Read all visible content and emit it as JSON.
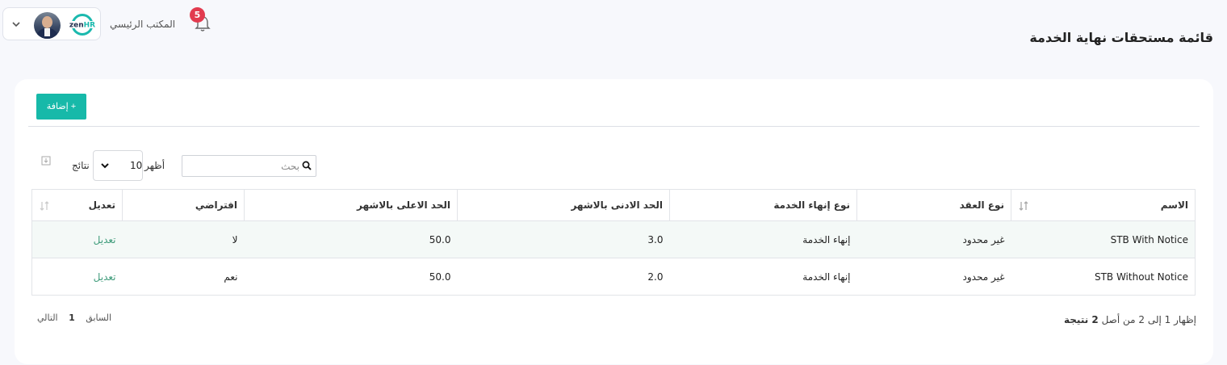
{
  "header": {
    "office_label": "المكتب الرئيسي",
    "notification_count": "5",
    "logo_text": "zenHR",
    "page_title": "قائمة مستحقات نهاية الخدمة"
  },
  "toolbar": {
    "add_label": "+ إضافة"
  },
  "controls": {
    "show_label": "أظهر",
    "page_size": "10",
    "results_label": "نتائج",
    "search_placeholder": "بحث"
  },
  "table": {
    "headers": [
      "الاسم",
      "نوع العقد",
      "نوع إنهاء الخدمة",
      "الحد الادنى بالاشهر",
      "الحد الاعلى بالاشهر",
      "افتراضي",
      "تعديل"
    ],
    "rows": [
      {
        "name": "STB With Notice",
        "contract_type": "غير محدود",
        "termination_type": "إنهاء الخدمة",
        "min_months": "3.0",
        "max_months": "50.0",
        "default": "لا",
        "edit": "تعديل"
      },
      {
        "name": "STB Without Notice",
        "contract_type": "غير محدود",
        "termination_type": "إنهاء الخدمة",
        "min_months": "2.0",
        "max_months": "50.0",
        "default": "نعم",
        "edit": "تعديل"
      }
    ]
  },
  "footer": {
    "info_prefix": "إظهار 1 إلى 2 من أصل",
    "info_total": "2 نتيجة",
    "prev_label": "السابق",
    "current_page": "1",
    "next_label": "التالي"
  },
  "colors": {
    "accent": "#17b9a9",
    "badge": "#e23b4f",
    "edit_link": "#3e9b7a"
  }
}
